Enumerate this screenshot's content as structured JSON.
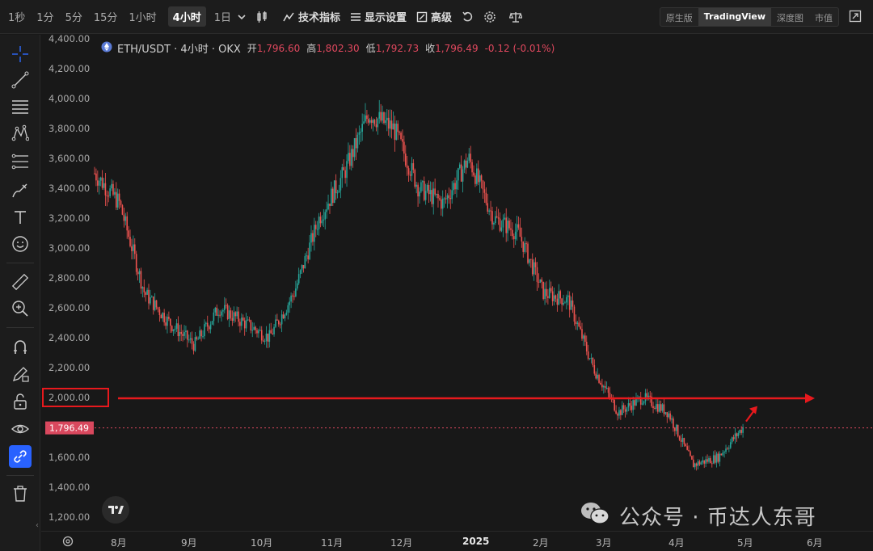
{
  "toolbar": {
    "timeframes": [
      "1秒",
      "1分",
      "5分",
      "15分",
      "1小时",
      "4小时",
      "1日"
    ],
    "active_timeframe": "4小时",
    "indicators_label": "技术指标",
    "display_label": "显示设置",
    "advanced_label": "高级",
    "views": [
      "原生版",
      "TradingView",
      "深度图",
      "市值"
    ],
    "active_view": "TradingView"
  },
  "legend": {
    "symbol": "ETH/USDT · 4小时 · OKX",
    "open_label": "开",
    "open": "1,796.60",
    "high_label": "高",
    "high": "1,802.30",
    "low_label": "低",
    "low": "1,792.73",
    "close_label": "收",
    "close": "1,796.49",
    "change": "-0.12 (-0.01%)"
  },
  "price_axis": {
    "ticks": [
      "4,400.00",
      "4,200.00",
      "4,000.00",
      "3,800.00",
      "3,600.00",
      "3,400.00",
      "3,200.00",
      "3,000.00",
      "2,800.00",
      "2,600.00",
      "2,400.00",
      "2,200.00",
      "2,000.00",
      "1,600.00",
      "1,400.00",
      "1,200.00"
    ],
    "current_price_label": "1,796.49",
    "highlighted_tick": "2,000.00"
  },
  "time_axis": {
    "labels": [
      "8月",
      "9月",
      "10月",
      "11月",
      "12月",
      "2025",
      "2月",
      "3月",
      "4月",
      "5月",
      "6月"
    ]
  },
  "watermark": {
    "text": "公众号 · 币达人东哥"
  },
  "colors": {
    "up": "#26a69a",
    "down": "#ef5350",
    "annotation": "#e8191d",
    "current_price": "#d9485e"
  },
  "chart_data": {
    "type": "candlestick",
    "title": "ETH/USDT · 4小时 · OKX",
    "ylim": [
      1200,
      4400
    ],
    "x": [
      "8月",
      "9月",
      "10月",
      "11月",
      "12月",
      "2025",
      "2月",
      "3月",
      "4月",
      "5月"
    ],
    "approx_close_path": [
      3500,
      3300,
      2700,
      2500,
      2350,
      2600,
      2500,
      2400,
      2700,
      3200,
      3500,
      3900,
      3800,
      3400,
      3300,
      3600,
      3200,
      3100,
      2700,
      2650,
      2200,
      1900,
      2000,
      1900,
      1550,
      1600,
      1800
    ],
    "annotations": {
      "horizontal_line_level": 2000,
      "current_price": 1796.49
    }
  }
}
